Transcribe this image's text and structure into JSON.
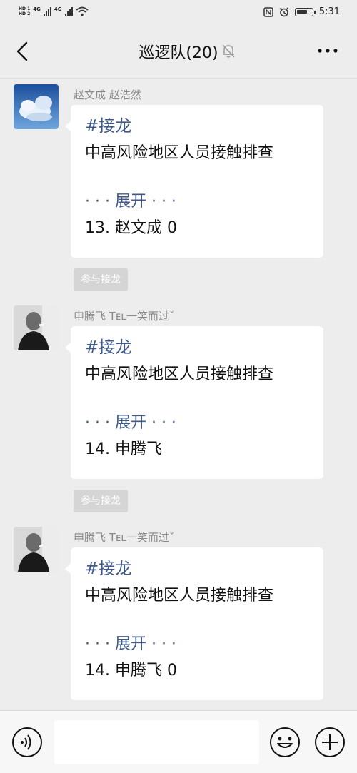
{
  "status_bar": {
    "hd1": "HD 1",
    "hd2": "HD 2",
    "net1": "4G",
    "net2": "4G",
    "time": "5:31"
  },
  "header": {
    "title": "巡逻队(20)"
  },
  "messages": [
    {
      "sender": "赵文成 赵浩然",
      "tag": "#接龙",
      "topic": "中高风险地区人员接触排查",
      "expand": "· · · 展开 · · ·",
      "entry": "13. 赵文成 0",
      "join_label": "参与接龙"
    },
    {
      "sender": "申腾飞 Tᴇʟ一笑而过ˇ",
      "tag": "#接龙",
      "topic": "中高风险地区人员接触排查",
      "expand": "· · · 展开 · · ·",
      "entry": "14. 申腾飞",
      "join_label": "参与接龙"
    },
    {
      "sender": "申腾飞 Tᴇʟ一笑而过ˇ",
      "tag": "#接龙",
      "topic": "中高风险地区人员接触排查",
      "expand": "· · · 展开 · · ·",
      "entry": "14. 申腾飞 0"
    }
  ],
  "input_bar": {
    "placeholder": ""
  },
  "icons": {
    "back": "back-arrow-icon",
    "mute": "bell-muted-icon",
    "more": "more-dots-icon",
    "voice": "voice-icon",
    "emoji": "emoji-icon",
    "plus": "plus-icon"
  },
  "colors": {
    "background": "#ededed",
    "bubble": "#ffffff",
    "link_blue": "#3f5a8a",
    "sender_gray": "#8a8a8a"
  }
}
